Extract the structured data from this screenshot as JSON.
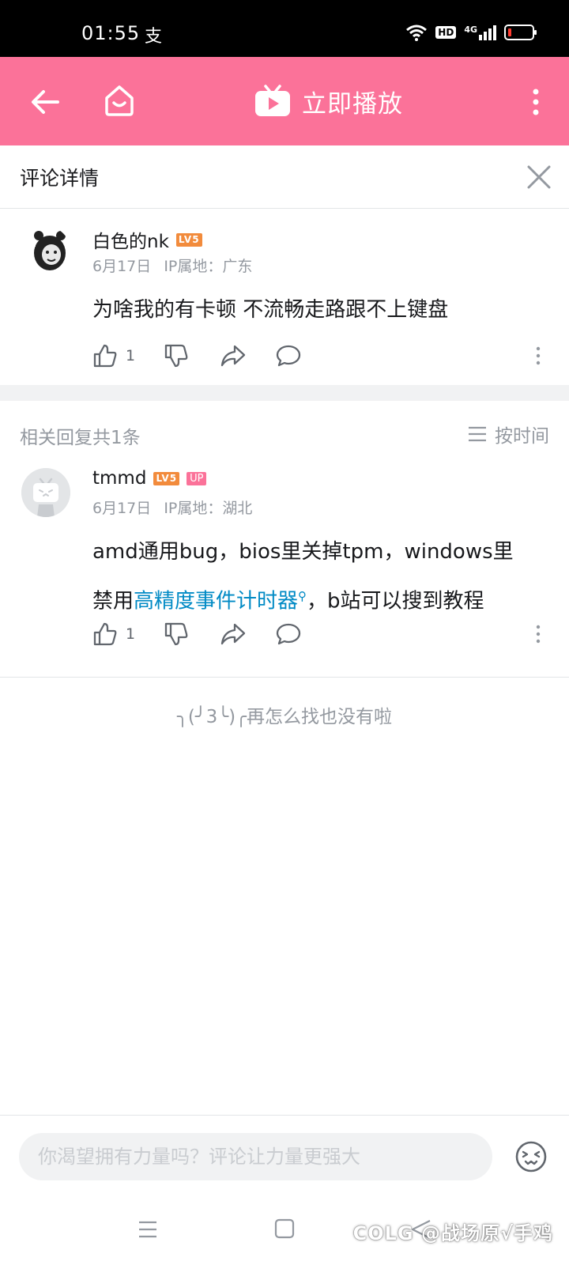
{
  "status_bar": {
    "time": "01:55",
    "message_icon_char": "支",
    "hd_label": "HD",
    "network_label": "4G"
  },
  "top_bar": {
    "play_now_label": "立即播放",
    "background_color": "#fb7299"
  },
  "sheet": {
    "title": "评论详情"
  },
  "main_comment": {
    "username": "白色的nk",
    "level_badge": "LV5",
    "date": "6月17日",
    "ip_location": "IP属地：广东",
    "text": "为啥我的有卡顿  不流畅走路跟不上键盘",
    "like_count": "1"
  },
  "replies": {
    "count_label": "相关回复共1条",
    "sort_label": "按时间",
    "items": [
      {
        "username": "tmmd",
        "level_badge": "LV5",
        "up_badge": "UP",
        "date": "6月17日",
        "ip_location": "IP属地：湖北",
        "text_line1": "amd通用bug，bios里关掉tpm，windows里",
        "text_line2_prefix": "禁用",
        "link_text": "高精度事件计时器",
        "search_mark": "⚲",
        "text_line2_suffix": "，b站可以搜到教程",
        "like_count": "1"
      }
    ],
    "end_hint": "╮(╯3╰)╭再怎么找也没有啦"
  },
  "input_bar": {
    "placeholder": "你渴望拥有力量吗？评论让力量更强大"
  },
  "watermark": "COLG @战场原√手鸡",
  "colors": {
    "accent": "#fb7299",
    "link": "#008ac5",
    "muted": "#9499a0",
    "level_badge": "#f28b3c"
  }
}
